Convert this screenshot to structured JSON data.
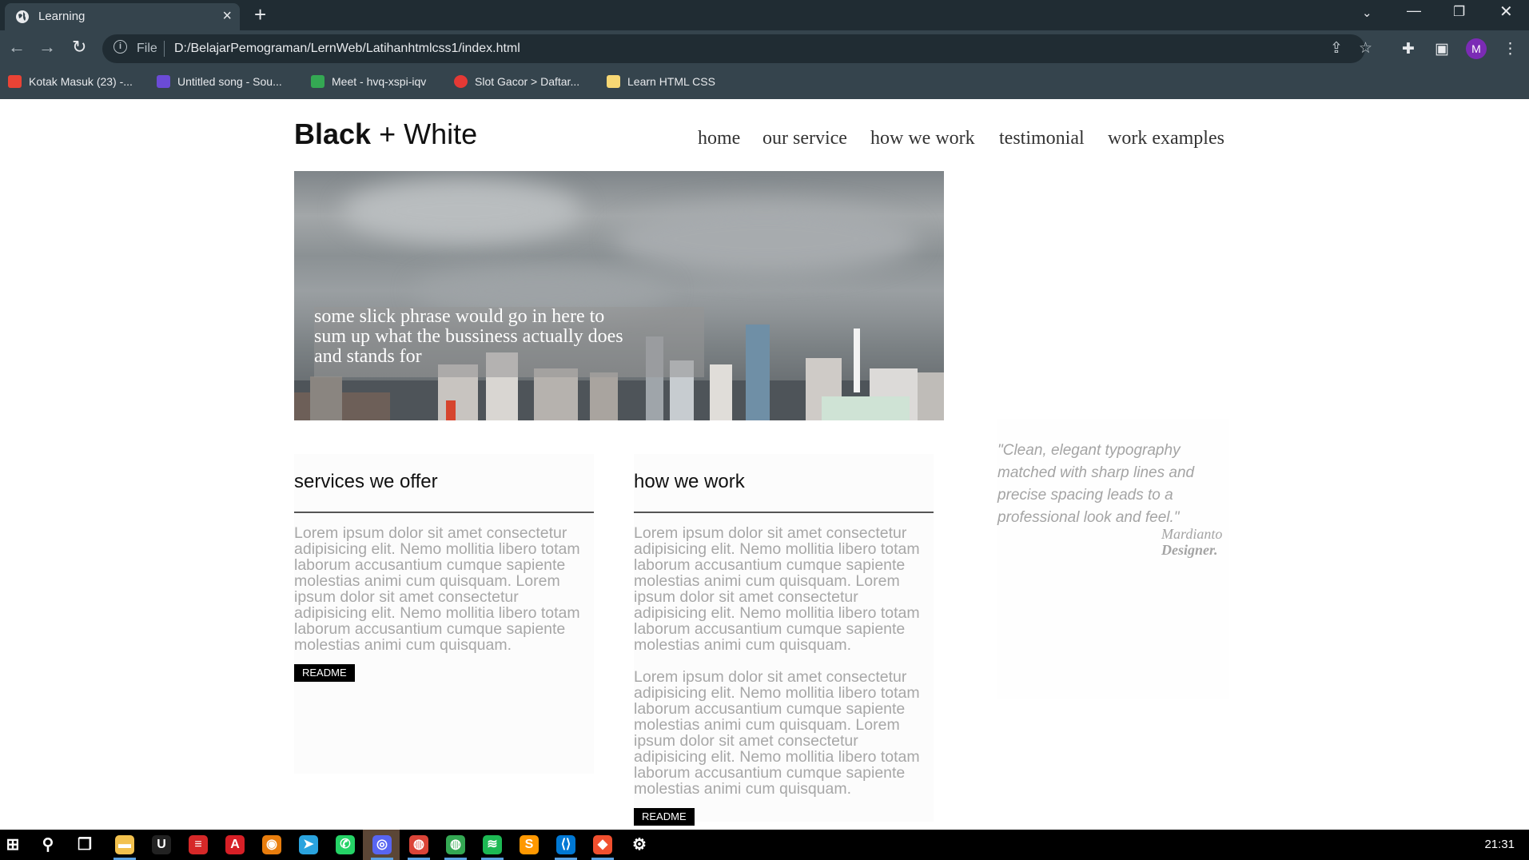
{
  "browser": {
    "tab_title": "Learning",
    "url_scheme": "File",
    "url": "D:/BelajarPemograman/LernWeb/Latihanhtmlcss1/index.html",
    "avatar_letter": "M",
    "bookmarks": [
      {
        "label": "Kotak Masuk (23) -...",
        "icon": "gmail-icon",
        "color": "#ea4335"
      },
      {
        "label": "Untitled song - Sou...",
        "icon": "soundtrap-icon",
        "color": "#6b4bd6"
      },
      {
        "label": "Meet - hvq-xspi-iqv",
        "icon": "meet-icon",
        "color": "#34a853"
      },
      {
        "label": "Slot Gacor > Daftar...",
        "icon": "slot-icon",
        "color": "#e53935"
      },
      {
        "label": "Learn HTML CSS",
        "icon": "folder-icon",
        "color": "#f7d774"
      }
    ]
  },
  "site": {
    "logo_bold": "Black",
    "logo_rest": " + White",
    "nav": [
      "home",
      "our service",
      "how we work",
      "testimonial",
      "work examples"
    ],
    "hero_caption": "some slick phrase would go in here to sum up what the bussiness actually does and stands for",
    "services": {
      "heading": "services we offer",
      "paragraphs": [
        "Lorem ipsum dolor sit amet consectetur adipisicing elit. Nemo mollitia libero totam laborum accusantium cumque sapiente molestias animi cum quisquam. Lorem ipsum dolor sit amet consectetur adipisicing elit. Nemo mollitia libero totam laborum accusantium cumque sapiente molestias animi cum quisquam."
      ],
      "button": "README"
    },
    "how": {
      "heading": "how we work",
      "paragraphs": [
        "Lorem ipsum dolor sit amet consectetur adipisicing elit. Nemo mollitia libero totam laborum accusantium cumque sapiente molestias animi cum quisquam. Lorem ipsum dolor sit amet consectetur adipisicing elit. Nemo mollitia libero totam laborum accusantium cumque sapiente molestias animi cum quisquam.",
        "Lorem ipsum dolor sit amet consectetur adipisicing elit. Nemo mollitia libero totam laborum accusantium cumque sapiente molestias animi cum quisquam. Lorem ipsum dolor sit amet consectetur adipisicing elit. Nemo mollitia libero totam laborum accusantium cumque sapiente molestias animi cum quisquam."
      ],
      "button": "README"
    },
    "testimonial": {
      "quote": "\"Clean, elegant typography matched with sharp lines and precise spacing leads to a professional look and feel.\"",
      "author_name": "Mardianto",
      "author_role": "Designer."
    }
  },
  "taskbar": {
    "clock": "21:31",
    "apps": [
      {
        "name": "windows-start-icon",
        "glyph": "⊞",
        "color": "#000"
      },
      {
        "name": "search-icon",
        "glyph": "⚲",
        "color": "#000"
      },
      {
        "name": "task-view-icon",
        "glyph": "❐",
        "color": "#000"
      },
      {
        "name": "file-explorer-icon",
        "glyph": "▬",
        "color": "#f2c14e"
      },
      {
        "name": "unreal-engine-icon",
        "glyph": "U",
        "color": "#222"
      },
      {
        "name": "pdf-reader-icon",
        "glyph": "≡",
        "color": "#d62828"
      },
      {
        "name": "acrobat-icon",
        "glyph": "A",
        "color": "#d71f26"
      },
      {
        "name": "blender-icon",
        "glyph": "◉",
        "color": "#e87d0d"
      },
      {
        "name": "telegram-icon",
        "glyph": "➤",
        "color": "#2aa3de"
      },
      {
        "name": "whatsapp-icon",
        "glyph": "✆",
        "color": "#25d366"
      },
      {
        "name": "discord-icon",
        "glyph": "◎",
        "color": "#5865f2"
      },
      {
        "name": "chrome-icon",
        "glyph": "◍",
        "color": "#db4437"
      },
      {
        "name": "chrome-profile-icon",
        "glyph": "◍",
        "color": "#34a853"
      },
      {
        "name": "spotify-icon",
        "glyph": "≋",
        "color": "#1db954"
      },
      {
        "name": "sublime-text-icon",
        "glyph": "S",
        "color": "#ff9800"
      },
      {
        "name": "vscode-icon",
        "glyph": "⟨⟩",
        "color": "#0078d4"
      },
      {
        "name": "git-icon",
        "glyph": "◆",
        "color": "#f1502f"
      },
      {
        "name": "settings-icon",
        "glyph": "⚙",
        "color": "#000"
      }
    ]
  }
}
